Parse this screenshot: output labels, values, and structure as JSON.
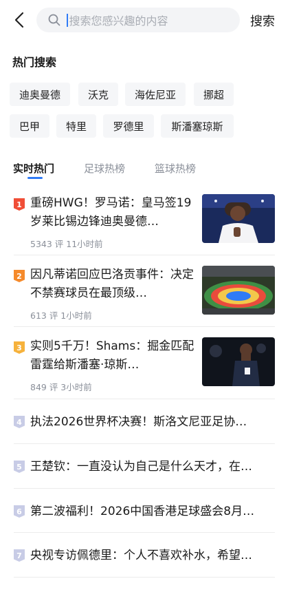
{
  "header": {
    "back_icon": "chevron-left-icon",
    "search_icon": "search-icon",
    "search_placeholder": "搜索您感兴趣的内容",
    "search_button": "搜索"
  },
  "hot_search": {
    "title": "热门搜索",
    "chips": [
      "迪奥曼德",
      "沃克",
      "海佐尼亚",
      "挪超",
      "巴甲",
      "特里",
      "罗德里",
      "斯潘塞琼斯"
    ]
  },
  "tabs": {
    "items": [
      "实时热门",
      "足球热榜",
      "篮球热榜"
    ],
    "active": "实时热门",
    "accent_color": "#2f7bf6"
  },
  "news": [
    {
      "rank": "1",
      "title": "重磅HWG！罗马诺：皇马签19岁莱比锡边锋迪奥曼德…",
      "meta": "5343 评  11小时前",
      "rank_color": "#f04e37"
    },
    {
      "rank": "2",
      "title": "因凡蒂诺回应巴洛贡事件：决定不禁赛球员在最顶级…",
      "meta": "613 评  1小时前",
      "rank_color": "#f58a2b"
    },
    {
      "rank": "3",
      "title": "实则5千万！Shams：掘金匹配雷霆给斯潘塞·琼斯…",
      "meta": "849 评  3小时前",
      "rank_color": "#f6b23c"
    },
    {
      "rank": "4",
      "title": "执法2026世界杯决赛！斯洛文尼亚足协…",
      "rank_color": "#c8cce6"
    },
    {
      "rank": "5",
      "title": "王楚钦：一直没认为自己是什么天才，在…",
      "rank_color": "#c8cce6"
    },
    {
      "rank": "6",
      "title": "第二波福利！2026中国香港足球盛会8月…",
      "rank_color": "#c8cce6"
    },
    {
      "rank": "7",
      "title": "央视专访佩德里：个人不喜欢补水，希望…",
      "rank_color": "#c8cce6"
    }
  ]
}
